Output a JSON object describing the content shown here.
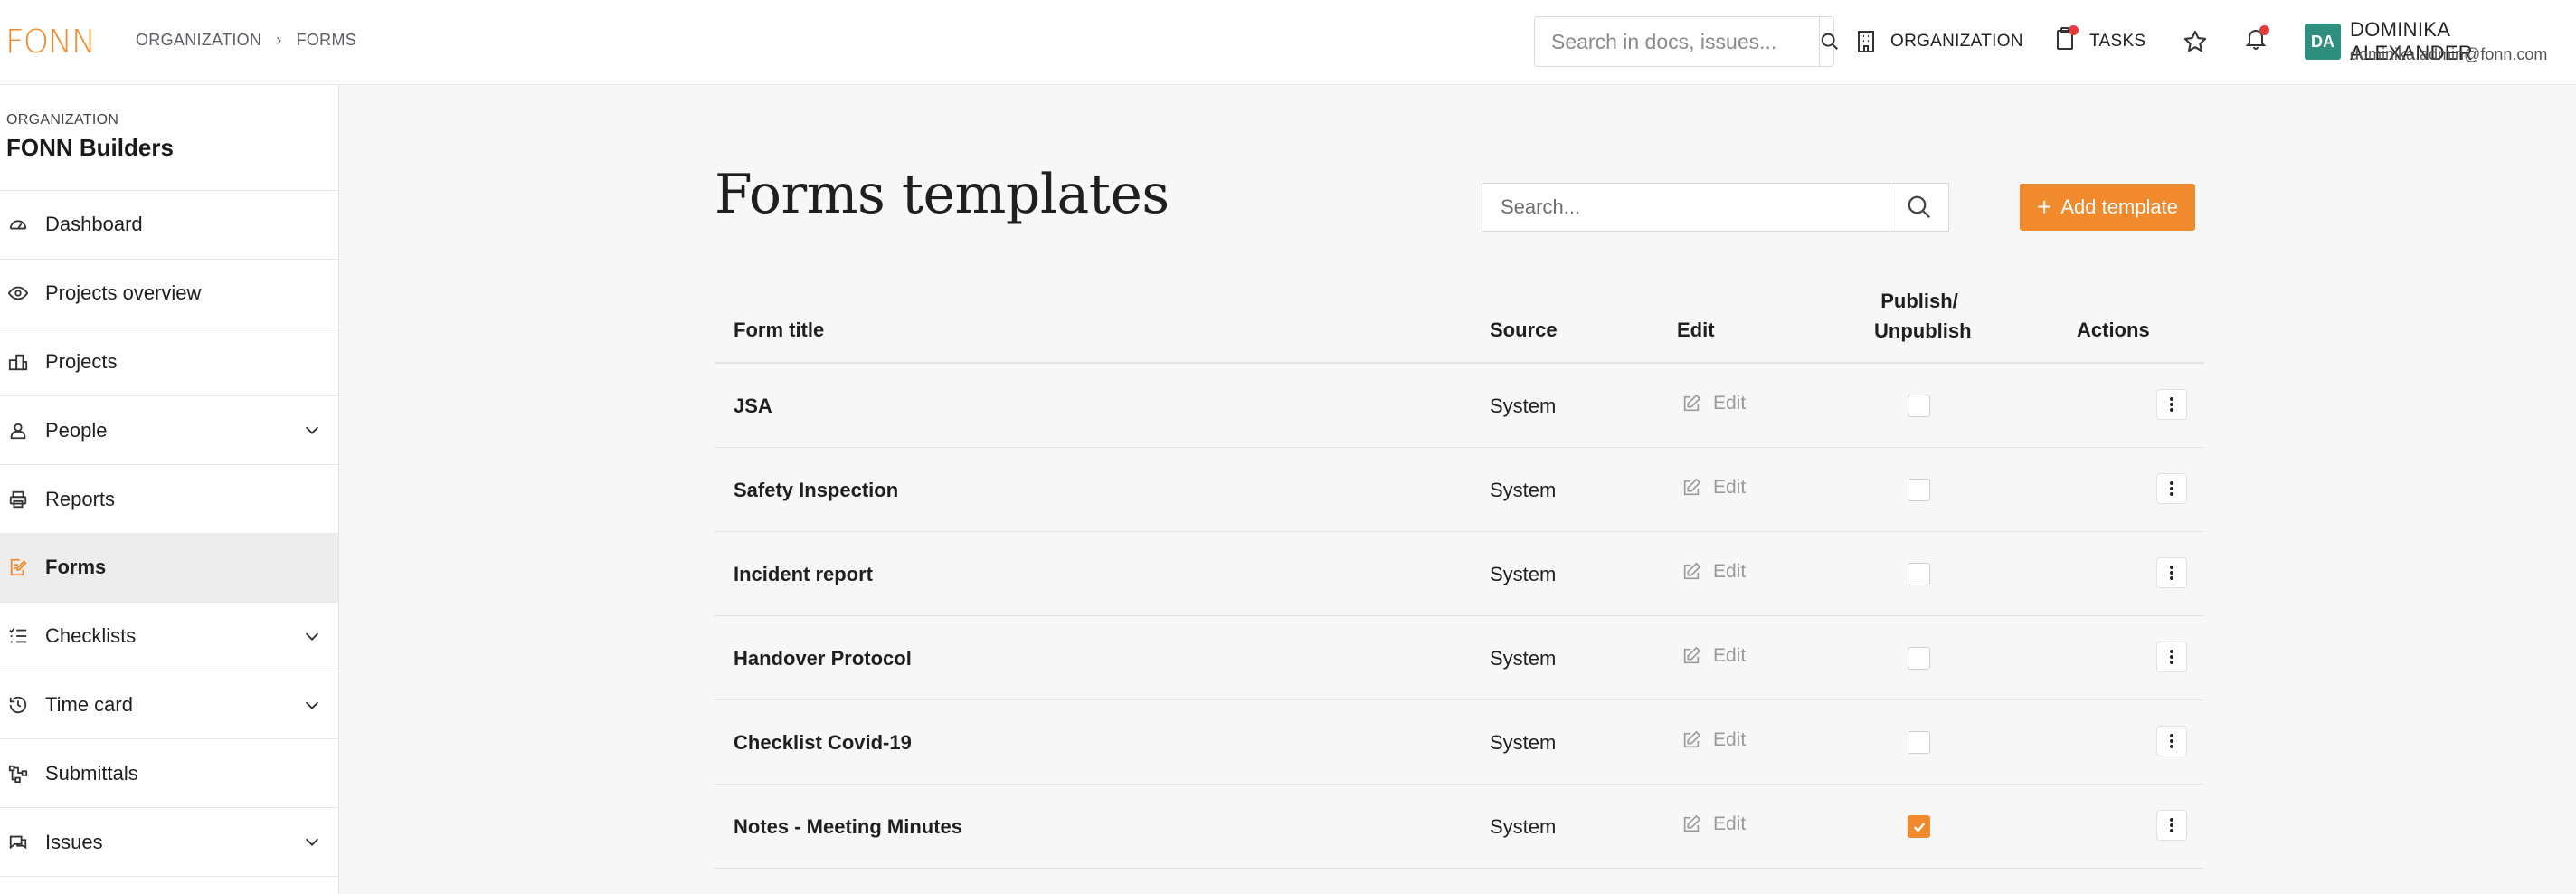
{
  "brand": {
    "logo_text": "FONN",
    "accent": "#f08a2c"
  },
  "breadcrumb": [
    "ORGANIZATION",
    "FORMS"
  ],
  "topbar": {
    "search_placeholder": "Search in docs, issues...",
    "organization_label": "ORGANIZATION",
    "tasks_label": "TASKS",
    "user": {
      "initials": "DA",
      "name": "DOMINIKA ALEXANDER",
      "email": "dominika.admin@fonn.com"
    }
  },
  "sidebar": {
    "org_label": "ORGANIZATION",
    "org_name": "FONN Builders",
    "items": [
      {
        "label": "Dashboard",
        "icon": "gauge-icon",
        "expandable": false,
        "active": false
      },
      {
        "label": "Projects overview",
        "icon": "eye-icon",
        "expandable": false,
        "active": false
      },
      {
        "label": "Projects",
        "icon": "buildings-icon",
        "expandable": false,
        "active": false
      },
      {
        "label": "People",
        "icon": "person-icon",
        "expandable": true,
        "active": false
      },
      {
        "label": "Reports",
        "icon": "printer-icon",
        "expandable": false,
        "active": false
      },
      {
        "label": "Forms",
        "icon": "form-edit-icon",
        "expandable": false,
        "active": true
      },
      {
        "label": "Checklists",
        "icon": "checklist-icon",
        "expandable": true,
        "active": false
      },
      {
        "label": "Time card",
        "icon": "history-icon",
        "expandable": true,
        "active": false
      },
      {
        "label": "Submittals",
        "icon": "flow-icon",
        "expandable": false,
        "active": false
      },
      {
        "label": "Issues",
        "icon": "chat-icon",
        "expandable": true,
        "active": false
      }
    ]
  },
  "main": {
    "title": "Forms templates",
    "search_placeholder": "Search...",
    "add_button_label": "Add template",
    "columns": {
      "title": "Form title",
      "source": "Source",
      "edit": "Edit",
      "publish_line1": "Publish/",
      "publish_line2": "Unpublish",
      "actions": "Actions"
    },
    "edit_label": "Edit",
    "rows": [
      {
        "title": "JSA",
        "source": "System",
        "published": false
      },
      {
        "title": "Safety Inspection",
        "source": "System",
        "published": false
      },
      {
        "title": "Incident report",
        "source": "System",
        "published": false
      },
      {
        "title": "Handover Protocol",
        "source": "System",
        "published": false
      },
      {
        "title": "Checklist Covid-19",
        "source": "System",
        "published": false
      },
      {
        "title": "Notes - Meeting Minutes",
        "source": "System",
        "published": true
      }
    ]
  }
}
